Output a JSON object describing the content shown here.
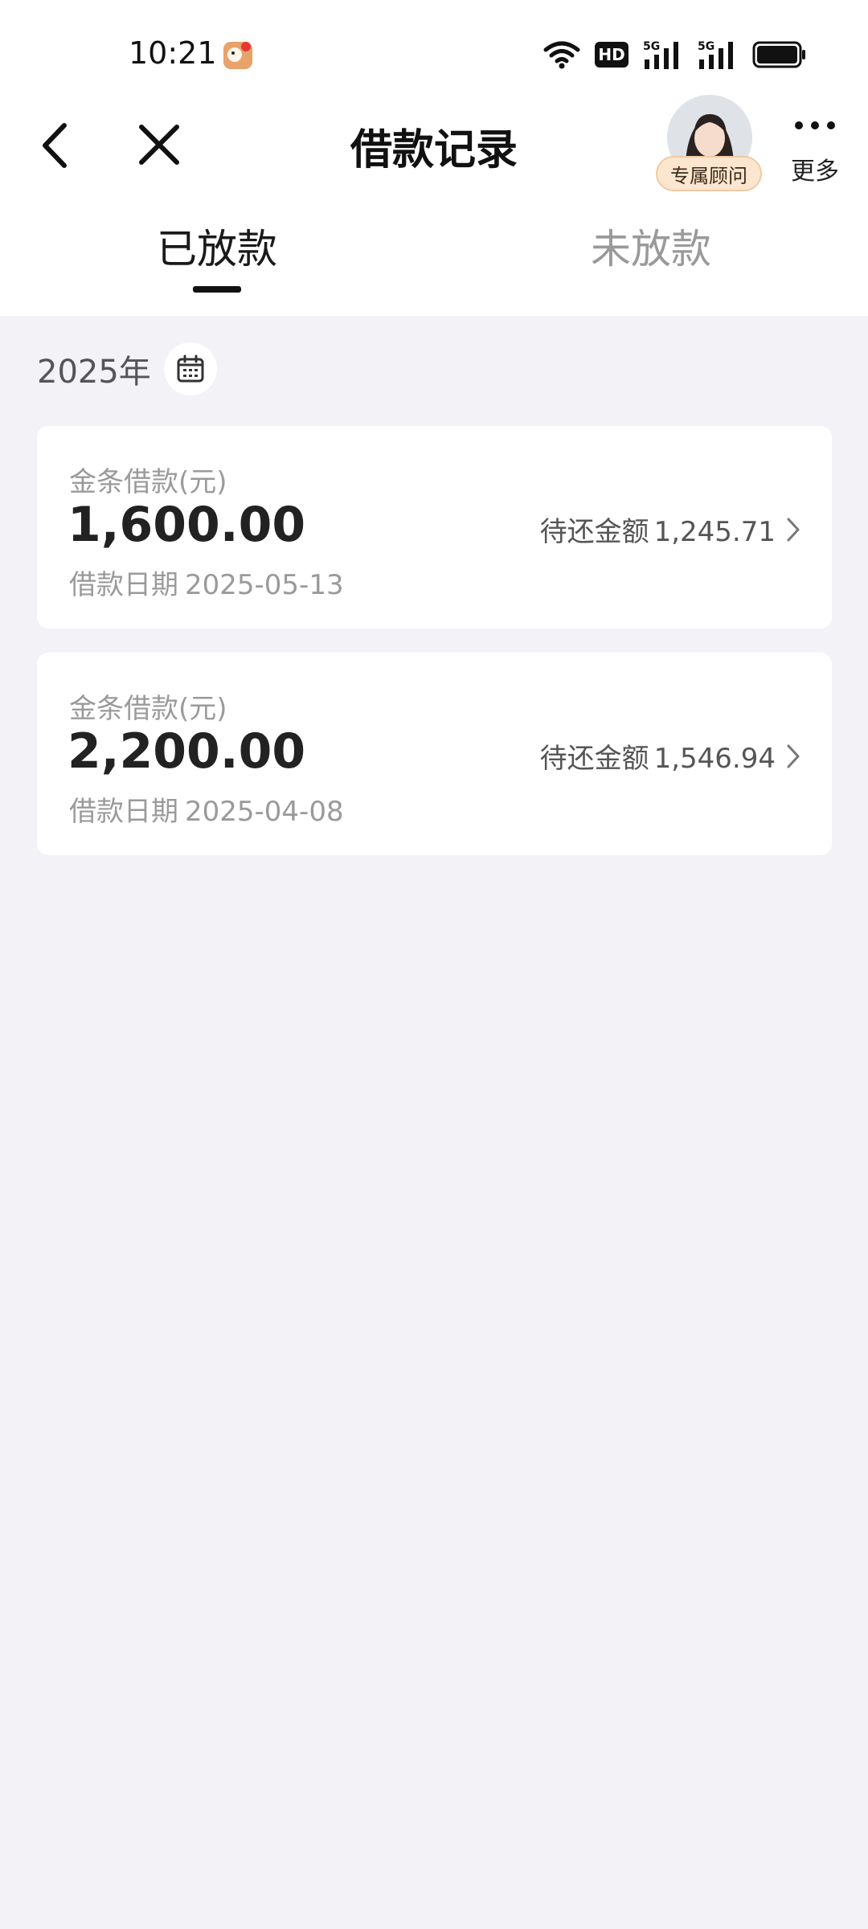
{
  "status_bar": {
    "time": "10:21",
    "icons": [
      "app-notification-icon",
      "wifi-icon",
      "hd-icon",
      "signal-5g-icon",
      "signal-5g-icon",
      "battery-icon"
    ],
    "hd_label": "HD"
  },
  "nav": {
    "title": "借款记录",
    "advisor_badge": "专属顾问",
    "more_label": "更多"
  },
  "tabs": [
    {
      "label": "已放款",
      "active": true
    },
    {
      "label": "未放款",
      "active": false
    }
  ],
  "filter": {
    "year": "2025年"
  },
  "loans": [
    {
      "type": "金条借款(元)",
      "amount": "1,600.00",
      "date_label": "借款日期",
      "date": "2025-05-13",
      "remaining_label": "待还金额",
      "remaining": "1,245.71"
    },
    {
      "type": "金条借款(元)",
      "amount": "2,200.00",
      "date_label": "借款日期",
      "date": "2025-04-08",
      "remaining_label": "待还金额",
      "remaining": "1,546.94"
    }
  ],
  "colors": {
    "background": "#f2f2f7",
    "card": "#ffffff",
    "badge": "#fde6cf",
    "inactive_text": "#9a9a9a"
  }
}
